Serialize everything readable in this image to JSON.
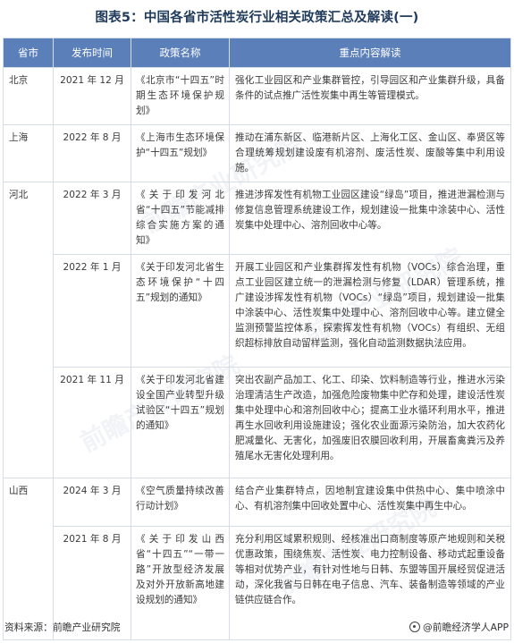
{
  "title": "图表5：中国各省市活性炭行业相关政策汇总及解读(一)",
  "headers": [
    "省市",
    "发布时间",
    "政策名称",
    "重点内容解读"
  ],
  "rows": [
    {
      "province": "北京",
      "date": "2021 年 12 月",
      "name": "《北京市“十四五”时期生态环境保护规划》",
      "content": "强化工业园区和产业集群管控，引导园区和产业集群升级，具备条件的试点推广活性炭集中再生等管理模式。"
    },
    {
      "province": "上海",
      "date": "2022 年 8 月",
      "name": "《上海市生态环境保护“十四五”规划》",
      "content": "推动在浦东新区、临港新片区、上海化工区、金山区、奉贤区等合理统筹规划建设废有机溶剂、废活性炭、废酸等集中利用设施。"
    },
    {
      "province": "河北",
      "date": "2022 年 3 月",
      "name": "《关于印发河北省“十四五”节能减排综合实施方案的通知》",
      "content": "推进涉挥发性有机物工业园区建设“绿岛”项目，推进泄漏检测与修复信息管理系统建设工作，规划建设一批集中涂装中心、活性炭集中处理中心、溶剂回收中心等。"
    },
    {
      "province": "",
      "date": "2022 年 1 月",
      "name": "《关于印发河北省生态环境保护“十四五”规划的通知》",
      "content": "开展工业园区和产业集群挥发性有机物（VOCs）综合治理，重点工业园区建立统一的泄漏检测与修复（LDAR）管理系统，推广建设涉挥发性有机物（VOCs）“绿岛”项目，规划建设一批集中涂装中心、活性炭集中处理中心、溶剂回收中心等。建立健全监测预警监控体系，探索挥发性有机物（VOCs）有组织、无组织超标排放自动留样监测，强化自动监测数据执法应用。"
    },
    {
      "province": "",
      "date": "2021 年 11 月",
      "name": "《关于印发河北省建设全国产业转型升级试验区“十四五”规划的通知》",
      "content": "突出农副产品加工、化工、印染、饮料制造等行业，推进水污染治理清洁生产改造，加强危险废物集中贮存和处理，建设活性炭集中处理中心和溶剂回收中心；提高工业水循环利用水平，推进再生水回收利用设施建设；强化农业面源污染防治，加大农药化肥减量化、无害化，加强废旧农膜回收利用，开展畜禽粪污及养殖尾水无害化处理利用。"
    },
    {
      "province": "山西",
      "date": "2024 年 3 月",
      "name": "《空气质量持续改善行动计划》",
      "content": "结合产业集群特点，因地制宜建设集中供热中心、集中喷涂中心、有机溶剂集中回收处置中心、活性炭集中再生中心。"
    },
    {
      "province": "",
      "date": "2021 年 8 月",
      "name": "《关于印发山西省“十四五”“一带一路”开放型经济发展及对外开放新高地建设规划的通知》",
      "content": "充分利用区域累积规则、经核准出口商制度等原产地规则和关税优惠政策，围绕焦炭、活性炭、电力控制设备、移动式起重设备等相对优势产业，有针对性地与日韩、东盟等国开展经贸促进活动，深化我省与日韩在电子信息、汽车、装备制造等领域的产业链供应链合作。"
    }
  ],
  "footer": {
    "source": "资料来源：前瞻产业研究院",
    "brand": "@前瞻经济学人APP"
  },
  "watermark_text": "前瞻产业研究院"
}
